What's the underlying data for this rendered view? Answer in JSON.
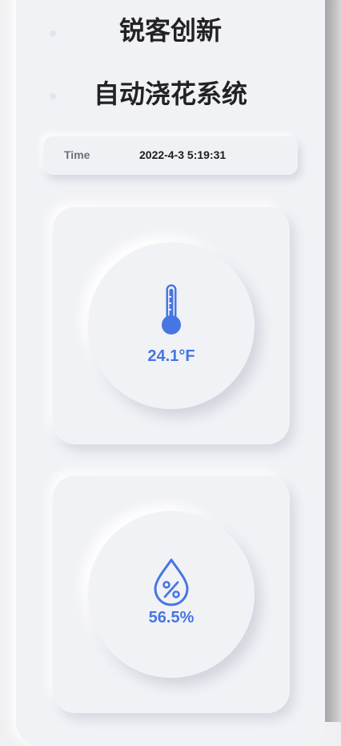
{
  "header": {
    "title_line1": "锐客创新",
    "title_line2": "自动浇花系统"
  },
  "time_bar": {
    "label": "Time",
    "value": "2022-4-3 5:19:31"
  },
  "temperature": {
    "icon": "thermometer-icon",
    "value": "24.1°F"
  },
  "humidity": {
    "icon": "humidity-drop-icon",
    "value": "56.5%"
  },
  "colors": {
    "accent": "#4676e3",
    "panel": "#f1f2f6"
  }
}
